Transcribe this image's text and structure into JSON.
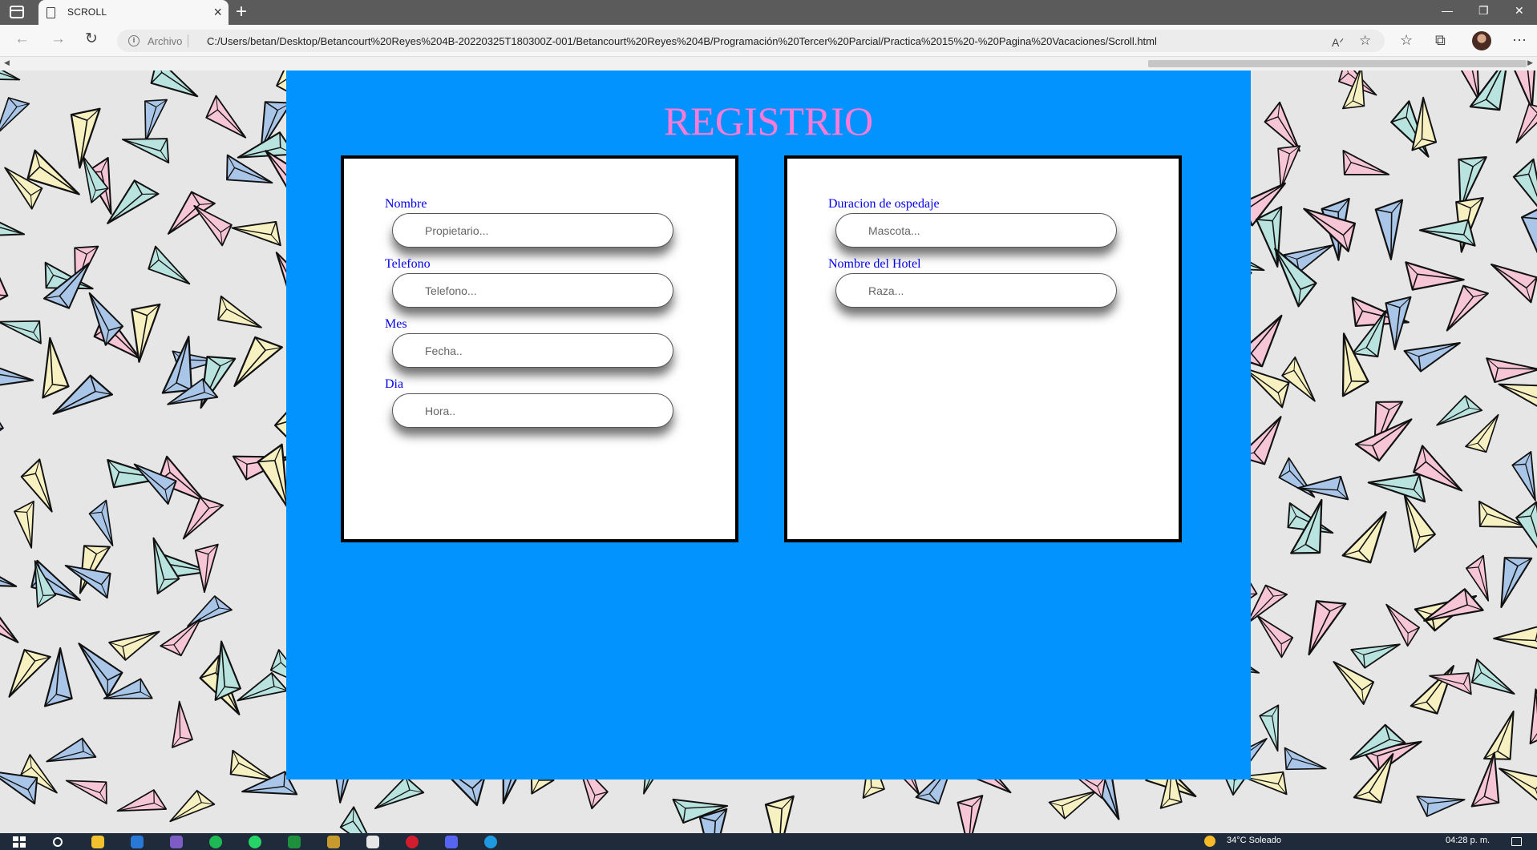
{
  "browser": {
    "tab_title": "SCROLL",
    "origin_label": "Archivo",
    "url": "C:/Users/betan/Desktop/Betancourt%20Reyes%204B-20220325T180300Z-001/Betancourt%20Reyes%204B/Programación%20Tercer%20Parcial/Practica%2015%20-%20Pagina%20Vacaciones/Scroll.html"
  },
  "page": {
    "title": "REGISTRIO",
    "colors": {
      "panel": "#0393fe",
      "title": "#ff7ad6",
      "labels": "#0000ee"
    },
    "left_form": [
      {
        "label": "Nombre",
        "placeholder": "Propietario..."
      },
      {
        "label": "Telefono",
        "placeholder": "Telefono..."
      },
      {
        "label": "Mes",
        "placeholder": "Fecha.."
      },
      {
        "label": "Dia",
        "placeholder": "Hora.."
      }
    ],
    "right_form": [
      {
        "label": "Duracion de ospedaje",
        "placeholder": "Mascota..."
      },
      {
        "label": "Nombre del Hotel",
        "placeholder": "Raza..."
      }
    ]
  },
  "taskbar": {
    "weather": "34°C Soleado",
    "time": "04:28 p. m."
  }
}
